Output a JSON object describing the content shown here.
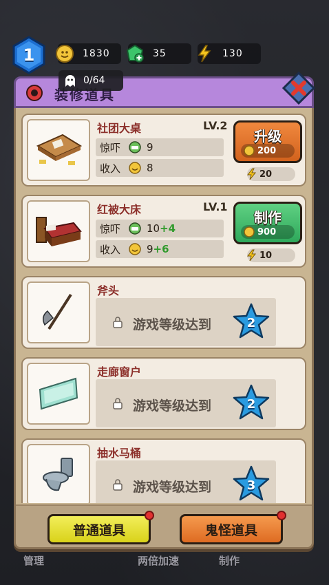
{
  "hud": {
    "level": "1",
    "coins": "1830",
    "gems": "35",
    "energy": "130"
  },
  "modal": {
    "title": "装修道具",
    "ghost_count": "0/64",
    "items": [
      {
        "name": "社团大桌",
        "level": "LV.2",
        "fear_label": "惊吓",
        "fear_value": "9",
        "fear_bonus": "",
        "income_label": "收入",
        "income_value": "8",
        "income_bonus": "",
        "action_label": "升级",
        "price": "200",
        "energy_cost": "20"
      },
      {
        "name": "红被大床",
        "level": "LV.1",
        "fear_label": "惊吓",
        "fear_value": "10",
        "fear_bonus": "+4",
        "income_label": "收入",
        "income_value": "9",
        "income_bonus": "+6",
        "action_label": "制作",
        "price": "900",
        "energy_cost": "10"
      },
      {
        "name": "斧头",
        "lock_text": "游戏等级达到",
        "required_level": "2"
      },
      {
        "name": "走廊窗户",
        "lock_text": "游戏等级达到",
        "required_level": "2"
      },
      {
        "name": "抽水马桶",
        "lock_text": "游戏等级达到",
        "required_level": "3"
      }
    ],
    "tabs": {
      "normal": "普通道具",
      "ghost": "鬼怪道具"
    }
  },
  "bottom_nav": {
    "left": "管理",
    "middle": "两倍加速",
    "right": "制作"
  }
}
